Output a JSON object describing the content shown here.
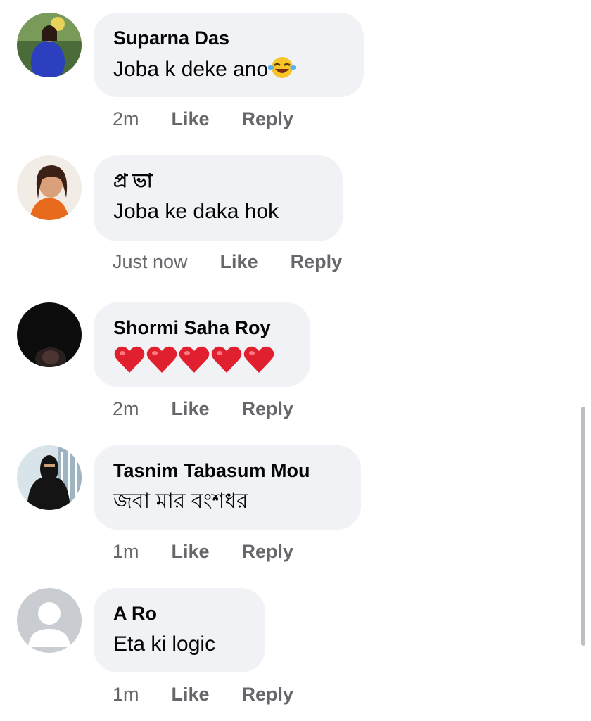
{
  "comments": [
    {
      "author": "Suparna Das",
      "text": "Joba k deke ano",
      "emoji": "laughing-crying-emoji",
      "time": "2m",
      "like": "Like",
      "reply": "Reply",
      "avatar": "profile-photo"
    },
    {
      "author": "প্র ভা",
      "text": "Joba ke daka hok",
      "time": "Just now",
      "like": "Like",
      "reply": "Reply",
      "avatar": "profile-photo"
    },
    {
      "author": "Shormi Saha Roy",
      "text": "",
      "emoji": "red-heart x5",
      "time": "2m",
      "like": "Like",
      "reply": "Reply",
      "avatar": "profile-photo"
    },
    {
      "author": "Tasnim Tabasum Mou",
      "text": "জবা মার বংশধর",
      "time": "1m",
      "like": "Like",
      "reply": "Reply",
      "avatar": "profile-photo"
    },
    {
      "author": "A Ro",
      "text": "Eta ki logic",
      "time": "1m",
      "like": "Like",
      "reply": "Reply",
      "avatar": "default-avatar"
    }
  ],
  "colors": {
    "bubble": "#f0f2f5",
    "meta": "#65676b",
    "text": "#050505",
    "heart": "#e0202e"
  }
}
